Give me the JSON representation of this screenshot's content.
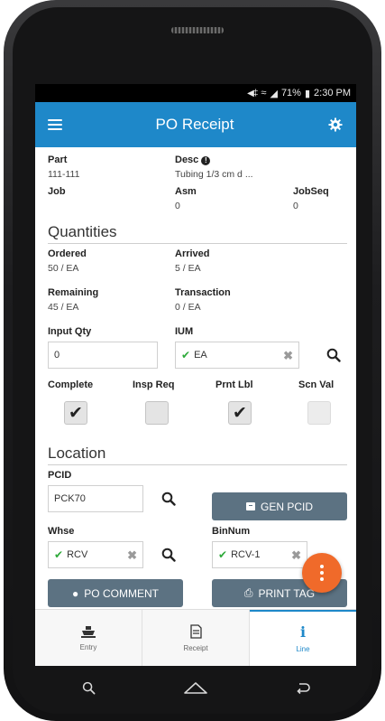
{
  "status": {
    "signal": "◀‡‡",
    "wifi": "•",
    "battery": "71%",
    "time": "2:30 PM"
  },
  "app": {
    "title": "PO Receipt",
    "menu_icon": "hamburger-icon",
    "settings_icon": "gear-icon"
  },
  "header_fields": {
    "part_label": "Part",
    "part_value": "111-111",
    "desc_label": "Desc",
    "desc_value": "Tubing 1/3 cm d ...",
    "job_label": "Job",
    "job_value": "",
    "asm_label": "Asm",
    "asm_value": "0",
    "jobseq_label": "JobSeq",
    "jobseq_value": "0"
  },
  "quantities": {
    "title": "Quantities",
    "ordered_label": "Ordered",
    "ordered_value": "50 / EA",
    "arrived_label": "Arrived",
    "arrived_value": "5 / EA",
    "remaining_label": "Remaining",
    "remaining_value": "45 / EA",
    "transaction_label": "Transaction",
    "transaction_value": "0 / EA",
    "input_qty_label": "Input Qty",
    "input_qty_value": "0",
    "ium_label": "IUM",
    "ium_value": "EA"
  },
  "checkboxes": [
    {
      "label": "Complete",
      "checked": true
    },
    {
      "label": "Insp Req",
      "checked": false
    },
    {
      "label": "Prnt Lbl",
      "checked": true
    },
    {
      "label": "Scn Val",
      "checked": false
    }
  ],
  "location": {
    "title": "Location",
    "pcid_label": "PCID",
    "pcid_value": "PCK70",
    "gen_pcid_label": "GEN PCID",
    "whse_label": "Whse",
    "whse_value": "RCV",
    "binnum_label": "BinNum",
    "binnum_value": "RCV-1"
  },
  "buttons": {
    "po_comment": "PO COMMENT",
    "print_tag": "PRINT TAG"
  },
  "tabs": [
    {
      "label": "Entry",
      "icon": "ship-icon",
      "active": false
    },
    {
      "label": "Receipt",
      "icon": "document-icon",
      "active": false
    },
    {
      "label": "Line",
      "icon": "info-icon",
      "active": true
    }
  ],
  "colors": {
    "primary": "#1e88c9",
    "button": "#5c7282",
    "fab": "#f06a2a",
    "check_green": "#2eaa3a"
  }
}
